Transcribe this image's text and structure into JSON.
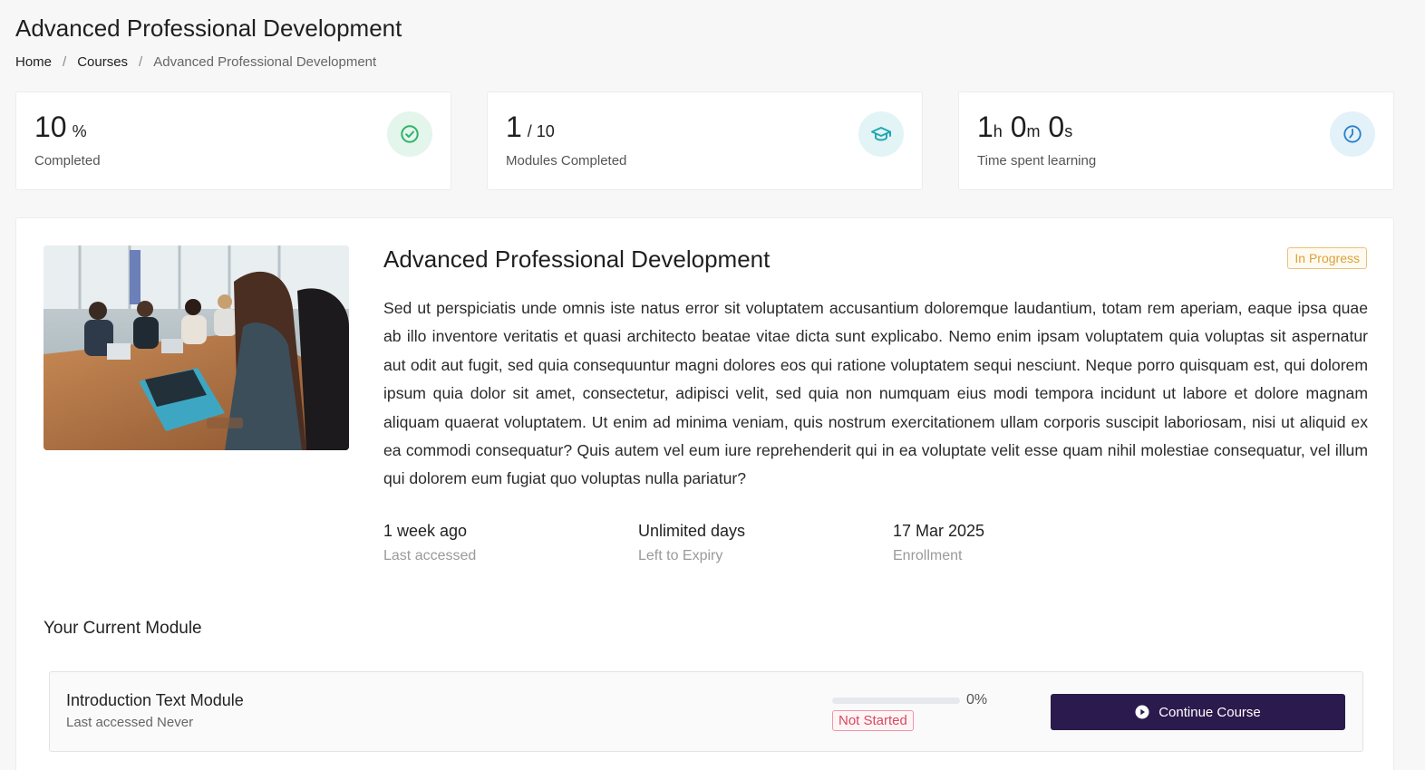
{
  "header": {
    "title": "Advanced Professional Development",
    "breadcrumb": {
      "home": "Home",
      "courses": "Courses",
      "current": "Advanced Professional Development",
      "separator": "/"
    }
  },
  "stats": [
    {
      "value": "10",
      "unit": "%",
      "label": "Completed",
      "icon": "check-circle-icon",
      "icon_color": "#2fb36b",
      "icon_bg": "#e4f5ec"
    },
    {
      "value": "1",
      "unit": "/ 10",
      "label": "Modules Completed",
      "icon": "graduation-cap-icon",
      "icon_color": "#22a6b3",
      "icon_bg": "#e2f4f6"
    },
    {
      "label": "Time spent learning",
      "icon": "clock-icon",
      "icon_color": "#2a7fc8",
      "icon_bg": "#e3f1f9",
      "time": {
        "h": "1",
        "h_unit": "h",
        "m": "0",
        "m_unit": "m",
        "s": "0",
        "s_unit": "s"
      }
    }
  ],
  "course": {
    "title": "Advanced Professional Development",
    "status": "In Progress",
    "description": "Sed ut perspiciatis unde omnis iste natus error sit voluptatem accusantium doloremque laudantium, totam rem aperiam, eaque ipsa quae ab illo inventore veritatis et quasi architecto beatae vitae dicta sunt explicabo. Nemo enim ipsam voluptatem quia voluptas sit aspernatur aut odit aut fugit, sed quia consequuntur magni dolores eos qui ratione voluptatem sequi nesciunt. Neque porro quisquam est, qui dolorem ipsum quia dolor sit amet, consectetur, adipisci velit, sed quia non numquam eius modi tempora incidunt ut labore et dolore magnam aliquam quaerat voluptatem. Ut enim ad minima veniam, quis nostrum exercitationem ullam corporis suscipit laboriosam, nisi ut aliquid ex ea commodi consequatur? Quis autem vel eum iure reprehenderit qui in ea voluptate velit esse quam nihil molestiae consequatur, vel illum qui dolorem eum fugiat quo voluptas nulla pariatur?",
    "meta": [
      {
        "value": "1 week ago",
        "label": "Last accessed"
      },
      {
        "value": "Unlimited days",
        "label": "Left to Expiry"
      },
      {
        "value": "17 Mar 2025",
        "label": "Enrollment"
      }
    ]
  },
  "current_module": {
    "section_title": "Your Current Module",
    "title": "Introduction Text Module",
    "subtitle": "Last accessed Never",
    "progress": 0,
    "progress_label": "0%",
    "status": "Not Started",
    "button_label": "Continue Course"
  }
}
